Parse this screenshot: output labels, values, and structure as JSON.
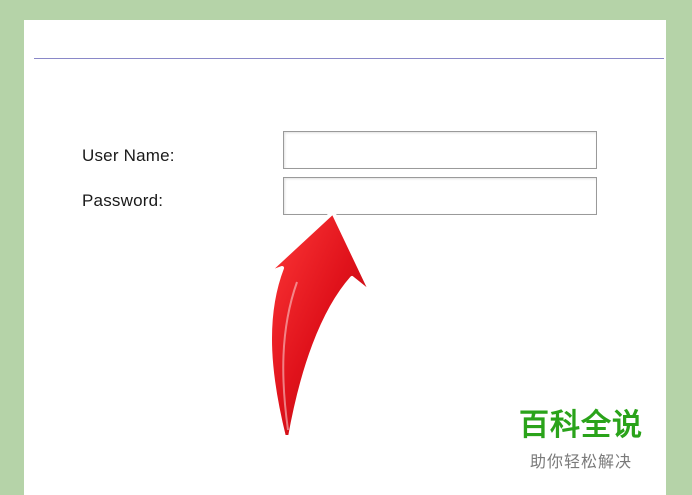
{
  "login_form": {
    "username_label": "User Name:",
    "username_value": "",
    "password_label": "Password:",
    "password_value": ""
  },
  "annotation": {
    "arrow_color": "#e0121b",
    "points_to": "password-field"
  },
  "watermark": {
    "name": "百科全说",
    "tagline": "助你轻松解决",
    "name_color": "#2aa31a"
  },
  "colors": {
    "frame_background": "#b5d3a8",
    "divider": "#8a88c8"
  }
}
